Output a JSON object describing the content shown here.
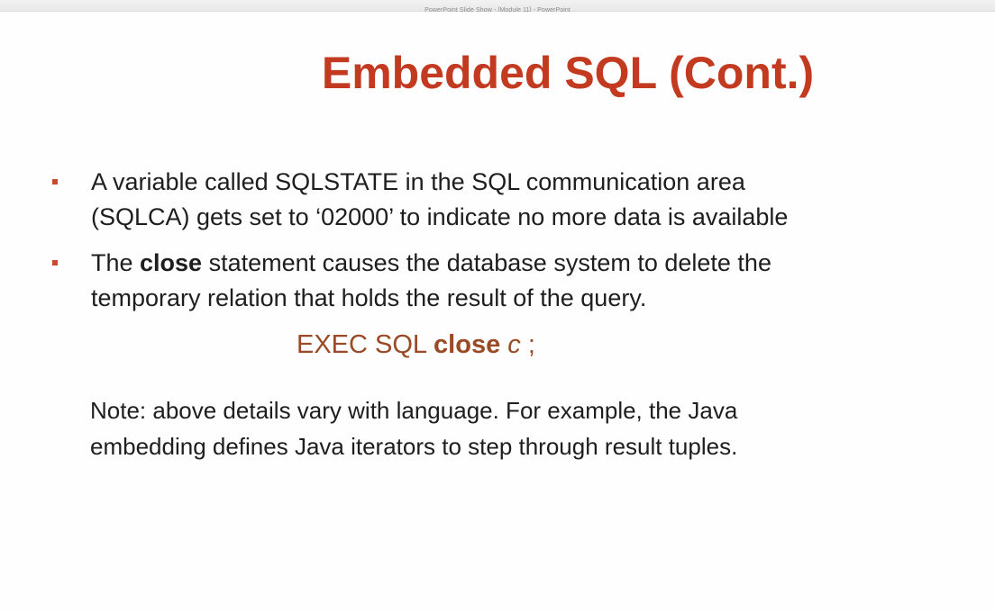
{
  "window": {
    "title": "PowerPoint Slide Show - [Module 11] - PowerPoint"
  },
  "slide": {
    "title": "Embedded SQL (Cont.)",
    "bullets": [
      {
        "lines": [
          "A variable called SQLSTATE in the SQL communication area",
          "(SQLCA) gets set to ‘02000’ to indicate no more data is available"
        ]
      },
      {
        "line1_prefix": "The ",
        "line1_bold": "close",
        "line1_suffix": " statement causes the database system to delete the",
        "line2": "temporary relation that holds the result of the query."
      }
    ],
    "code": {
      "prefix": "EXEC SQL ",
      "keyword": "close",
      "variable": "c",
      "suffix": " ;"
    },
    "note": {
      "lines": [
        "Note: above details vary with language.  For example, the Java",
        "embedding defines Java iterators to step through result tuples."
      ]
    }
  },
  "colors": {
    "title": "#c23a1f",
    "bullet": "#c94a2a",
    "code": "#9a4a25",
    "text": "#1e1e1e"
  }
}
